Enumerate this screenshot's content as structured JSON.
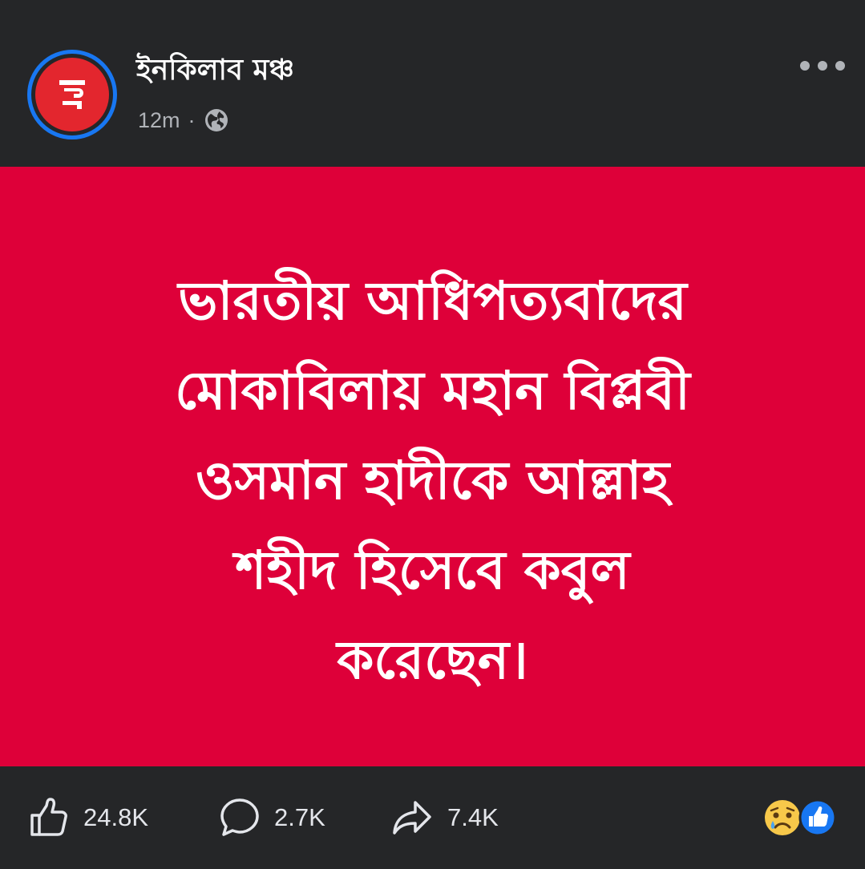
{
  "post": {
    "page_name": "ইনকিলাব মঞ্চ",
    "avatar_letter": "ই",
    "time": "12m",
    "separator": "·",
    "privacy_icon": "globe-icon",
    "more_icon": "more-dots-icon",
    "body_lines": [
      "ভারতীয় আধিপত্যবাদের",
      "মোকাবিলায় মহান বিপ্লবী",
      "ওসমান হাদীকে আল্লাহ",
      "শহীদ হিসেবে কবুল",
      "করেছেন।"
    ],
    "background_color": "#de0039"
  },
  "actions": {
    "like_count": "24.8K",
    "comment_count": "2.7K",
    "share_count": "7.4K"
  },
  "reactions": [
    "sad-reaction-icon",
    "like-reaction-icon"
  ],
  "colors": {
    "surface": "#252628",
    "accent": "#1877f2",
    "avatar_red": "#e3262e",
    "text_muted": "#b0b3b8"
  }
}
